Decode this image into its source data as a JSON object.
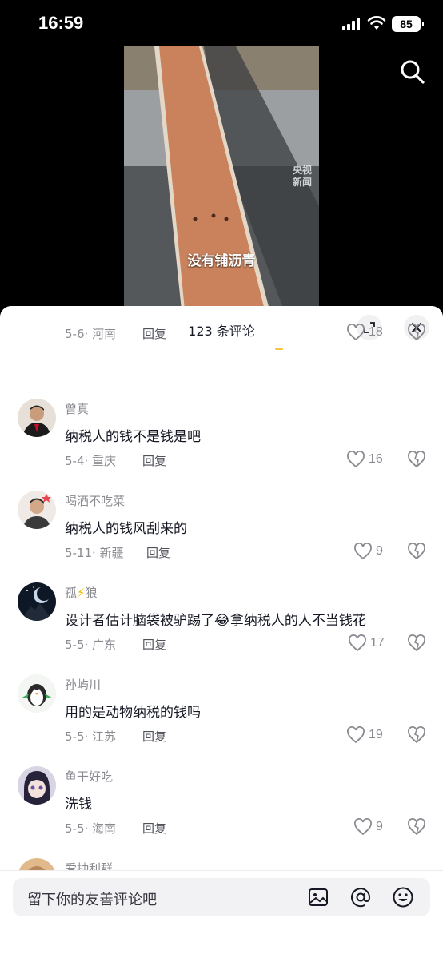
{
  "status_bar": {
    "time": "16:59",
    "battery": "85"
  },
  "video": {
    "subtitle": "没有铺沥青",
    "watermark_line1": "央视",
    "watermark_line2": "新闻"
  },
  "sheet": {
    "title": "123 条评论"
  },
  "comments": [
    {
      "username": "",
      "text": "",
      "date": "5-6",
      "region": "河南",
      "reply": "回复",
      "likes": "18"
    },
    {
      "username": "曾真",
      "text": "纳税人的钱不是钱是吧",
      "date": "5-4",
      "region": "重庆",
      "reply": "回复",
      "likes": "16"
    },
    {
      "username": "喝酒不吃菜",
      "text": "纳税人的钱风刮来的",
      "date": "5-11",
      "region": "新疆",
      "reply": "回复",
      "likes": "9"
    },
    {
      "username_part1": "孤",
      "username_emoji": "⚡",
      "username_part2": "狼",
      "text_part1": "设计者估计脑袋被驴踢了",
      "text_emoji": "😂",
      "text_part2": "拿纳税人的人不当钱花",
      "date": "5-5",
      "region": "广东",
      "reply": "回复",
      "likes": "17"
    },
    {
      "username": "孙屿川",
      "text": "用的是动物纳税的钱吗",
      "date": "5-5",
      "region": "江苏",
      "reply": "回复",
      "likes": "19"
    },
    {
      "username": "鱼干好吃",
      "text": "洗钱",
      "date": "5-5",
      "region": "海南",
      "reply": "回复",
      "likes": "9"
    },
    {
      "username": "爱抽利群"
    }
  ],
  "input": {
    "placeholder": "留下你的友善评论吧"
  },
  "icons": {
    "search": "search-icon",
    "expand": "expand-icon",
    "close": "close-icon",
    "heart": "heart-icon",
    "dislike": "broken-heart-icon",
    "image": "image-icon",
    "at": "at-icon",
    "emoji": "emoji-icon"
  },
  "colors": {
    "accent_yellow": "#f5c744",
    "text_primary": "#161823",
    "text_secondary": "#8a8b91"
  }
}
